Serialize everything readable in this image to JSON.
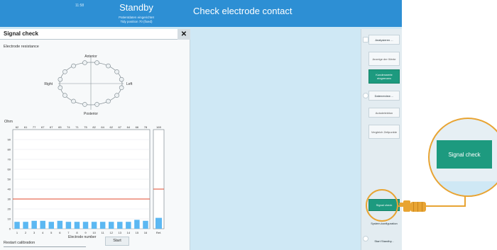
{
  "header": {
    "time": "11:58",
    "status": "Standby",
    "sub_line1": "Patientdaten eingerichtet",
    "sub_line2": "Tidy position 70 (fixed)",
    "page_title": "Check electrode contact"
  },
  "panel": {
    "title": "Signal check",
    "close_icon": "close-icon",
    "resistance_label": "Electrode resistance",
    "anterior": "Anterior",
    "posterior": "Posterior",
    "right": "Right",
    "left": "Left",
    "ohm_label": "Ohm",
    "electrode_number_label": "Electrode number",
    "ref_label": "Ref.",
    "restart_label": "Restart calibration",
    "start_label": "Start"
  },
  "side_buttons": {
    "analysis": "Analysieren ...",
    "show_values": "Anzeige der Werte",
    "custom_values": "Kundenwerte eingrenzen",
    "data_review": "Datenreview ...",
    "autodetect": "Autodetektion",
    "compare": "Vergleich Zeitpunkte",
    "signal_check": "Signal check",
    "system_config": "System-konfiguration",
    "start_standby": "Start Standby..."
  },
  "zoom": {
    "label": "Signal check"
  },
  "colors": {
    "header_blue": "#2d8fd4",
    "bar_blue": "#5cb8f2",
    "teal": "#1d9a7f",
    "highlight_orange": "#e8a433",
    "threshold_red": "#e2492e"
  },
  "chart_data": {
    "type": "bar",
    "categories": [
      "1",
      "2",
      "3",
      "4",
      "5",
      "6",
      "7",
      "8",
      "9",
      "10",
      "11",
      "12",
      "13",
      "14",
      "15",
      "16"
    ],
    "values": [
      7,
      7,
      8,
      8,
      7,
      8,
      7,
      7,
      7,
      7,
      7,
      7,
      7,
      7,
      9,
      8
    ],
    "top_labels": [
      "62",
      "61",
      "77",
      "67",
      "67",
      "65",
      "74",
      "71",
      "75",
      "82",
      "64",
      "62",
      "67",
      "64",
      "66",
      "78"
    ],
    "threshold": 30,
    "ylim": [
      0,
      100
    ],
    "yticks": [
      0,
      10,
      20,
      30,
      40,
      50,
      60,
      70,
      80,
      90
    ],
    "ylabel": "Ohm",
    "xlabel": "Electrode number",
    "ref": {
      "label": "Ref.",
      "value": 11,
      "top_label": "169",
      "threshold": 40
    }
  }
}
